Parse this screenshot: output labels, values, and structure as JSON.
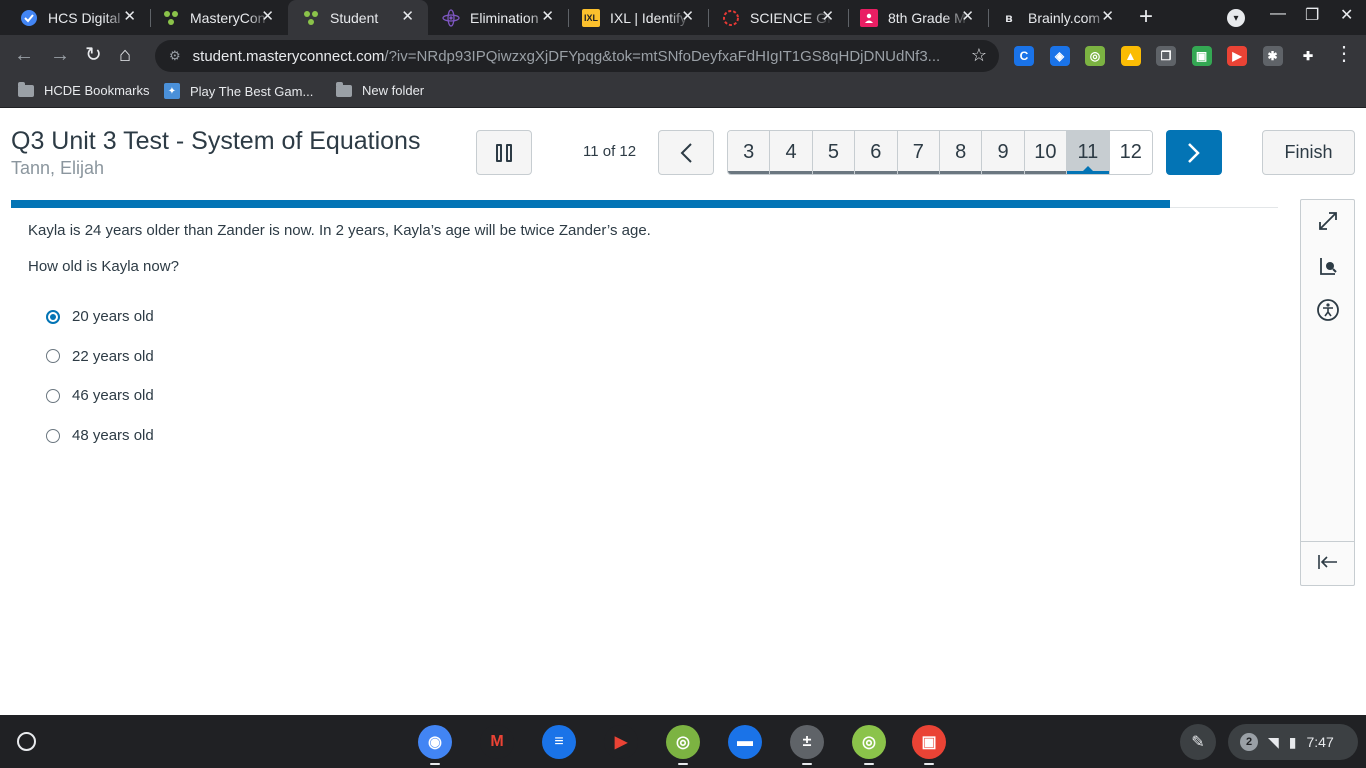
{
  "browser": {
    "tabs": [
      {
        "title": "HCS Digital",
        "favicon": "hcs-icon",
        "active": false
      },
      {
        "title": "MasteryCon",
        "favicon": "masteryconnect-icon",
        "active": false
      },
      {
        "title": "Student",
        "favicon": "masteryconnect-icon",
        "active": true
      },
      {
        "title": "Elimination",
        "favicon": "atom-icon",
        "active": false
      },
      {
        "title": "IXL | Identify",
        "favicon": "ixl-icon",
        "active": false
      },
      {
        "title": "SCIENCE GI",
        "favicon": "spinner-icon",
        "active": false
      },
      {
        "title": "8th Grade M",
        "favicon": "classroom-icon",
        "active": false
      },
      {
        "title": "Brainly.com",
        "favicon": "brainly-icon",
        "active": false
      }
    ],
    "url_host": "student.masteryconnect.com",
    "url_path": "/?iv=NRdp93IPQiwzxgXjDFYpqg&tok=mtSNfoDeyfxaFdHIgIT1GS8qHDjDNUdNf3...",
    "bookmarks": [
      {
        "label": "HCDE Bookmarks",
        "icon": "folder-icon"
      },
      {
        "label": "Play The Best Gam...",
        "icon": "game-icon"
      },
      {
        "label": "New folder",
        "icon": "folder-icon"
      }
    ],
    "extensions": [
      {
        "name": "c-extension-icon",
        "letter": "C",
        "color": "#1a73e8"
      },
      {
        "name": "shield-extension-icon",
        "letter": "◈",
        "color": "#1a73e8"
      },
      {
        "name": "masteryconnect-extension-icon",
        "letter": "◎",
        "color": "#7cb342"
      },
      {
        "name": "drive-extension-icon",
        "letter": "▲",
        "color": "#fbbc04"
      },
      {
        "name": "copies-extension-icon",
        "letter": "❐",
        "color": "#5f6368"
      },
      {
        "name": "classroom-extension-icon",
        "letter": "▣",
        "color": "#34a853"
      },
      {
        "name": "screencast-extension-icon",
        "letter": "▶",
        "color": "#ea4335"
      },
      {
        "name": "bug-extension-icon",
        "letter": "✱",
        "color": "#5f6368"
      },
      {
        "name": "puzzle-extension-icon",
        "letter": "✚",
        "color": "#35363a"
      }
    ]
  },
  "test": {
    "title": "Q3 Unit 3 Test - System of Equations",
    "student": "Tann, Elijah",
    "counter": "11 of 12",
    "question_numbers": [
      "3",
      "4",
      "5",
      "6",
      "7",
      "8",
      "9",
      "10",
      "11",
      "12"
    ],
    "current_question": "11",
    "finish_label": "Finish",
    "progress_fraction": 0.915
  },
  "question": {
    "stem": "Kayla is 24 years older than Zander is now. In 2 years, Kayla’s age will be twice Zander’s age.",
    "prompt": "How old is Kayla now?",
    "choices": [
      {
        "label": "20 years old",
        "selected": true
      },
      {
        "label": "22 years old",
        "selected": false
      },
      {
        "label": "46 years old",
        "selected": false
      },
      {
        "label": "48 years old",
        "selected": false
      }
    ]
  },
  "tools": [
    "expand-icon",
    "magnifier-icon",
    "accessibility-icon",
    "collapse-panel-icon"
  ],
  "shelf": {
    "apps": [
      {
        "name": "chrome-app-icon",
        "color": "#4285f4"
      },
      {
        "name": "gmail-app-icon",
        "color": "#ffffff"
      },
      {
        "name": "docs-app-icon",
        "color": "#1a73e8"
      },
      {
        "name": "play-store-app-icon",
        "color": "#ffffff"
      },
      {
        "name": "masteryconnect-app-icon",
        "color": "#7cb342"
      },
      {
        "name": "files-app-icon",
        "color": "#1a73e8"
      },
      {
        "name": "calculator-app-icon",
        "color": "#5f6368"
      },
      {
        "name": "masteryconnect-student-app-icon",
        "color": "#8bc34a"
      },
      {
        "name": "gallery-app-icon",
        "color": "#ea4335"
      }
    ],
    "notification_count": "2",
    "time": "7:47"
  },
  "colors": {
    "accent": "#0374b5",
    "text": "#2d3b45",
    "muted": "#8b969e"
  }
}
